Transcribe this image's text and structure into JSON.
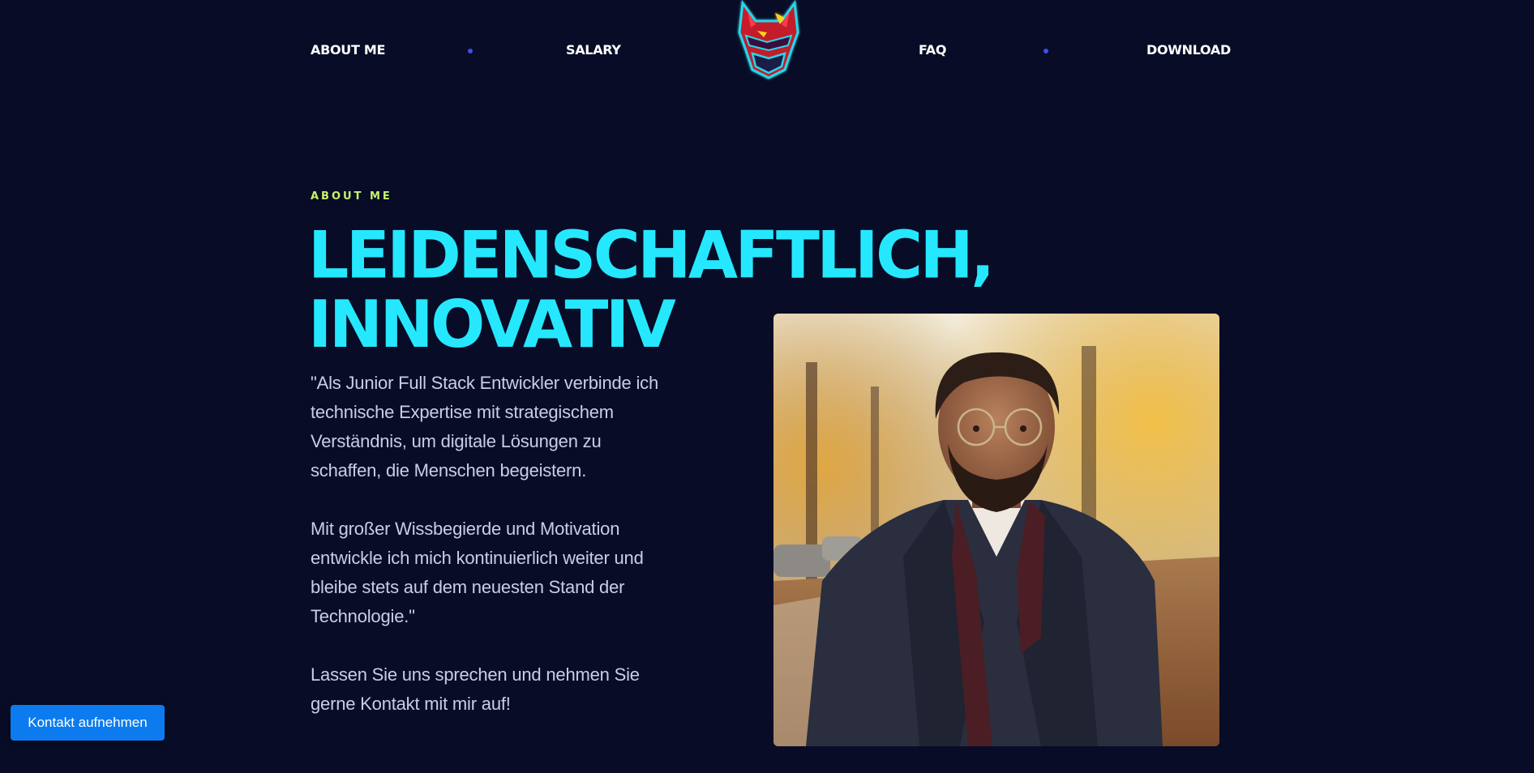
{
  "nav": {
    "about_label": "ABOUT ME",
    "salary_label": "SALARY",
    "faq_label": "FAQ",
    "download_label": "DOWNLOAD",
    "logo_icon": "fox-mask-logo"
  },
  "hero": {
    "eyebrow": "ABOUT ME",
    "headline_line1": "LEIDENSCHAFTLICH,",
    "headline_line2": "INNOVATIV",
    "paragraph1": "\"Als Junior Full Stack Entwickler verbinde ich technische Expertise mit strategischem Verständnis, um digitale Lösungen zu schaffen, die Menschen begeistern.",
    "paragraph2": "Mit großer Wissbegierde und Motivation entwickle ich mich kontinuierlich weiter und bleibe stets auf dem neuesten Stand der Technologie.\"",
    "paragraph3": "Lassen Sie uns sprechen und nehmen Sie gerne Kontakt mit mir auf!"
  },
  "cta": {
    "label": "Kontakt aufnehmen"
  },
  "colors": {
    "background": "#080c26",
    "accent_cyan": "#25e8ff",
    "accent_lime": "#c6f26b",
    "nav_dot": "#3b4ff0",
    "button": "#0b7bef"
  }
}
